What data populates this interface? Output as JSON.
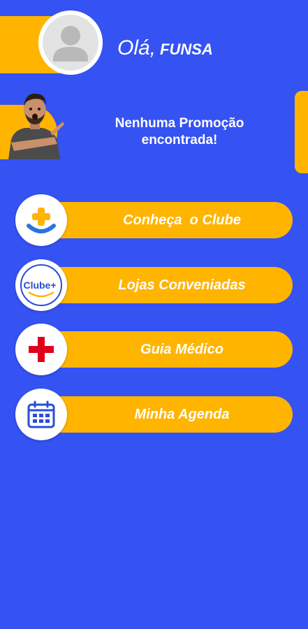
{
  "header": {
    "greeting": "Olá,",
    "username": "FUNSA"
  },
  "promo": {
    "message": "Nenhuma Promoção encontrada!"
  },
  "menu": [
    {
      "label": "Conheça  o Clube",
      "icon": "clube-plus-smile-icon"
    },
    {
      "label": "Lojas Conveniadas",
      "icon": "clube-plus-logo-icon",
      "icon_text": "Clube+"
    },
    {
      "label": "Guia Médico",
      "icon": "red-cross-icon"
    },
    {
      "label": "Minha Agenda",
      "icon": "calendar-icon"
    }
  ],
  "colors": {
    "background": "#3552F2",
    "accent": "#FFB400",
    "red": "#E0001B",
    "icon_blue": "#2A4DD8"
  }
}
